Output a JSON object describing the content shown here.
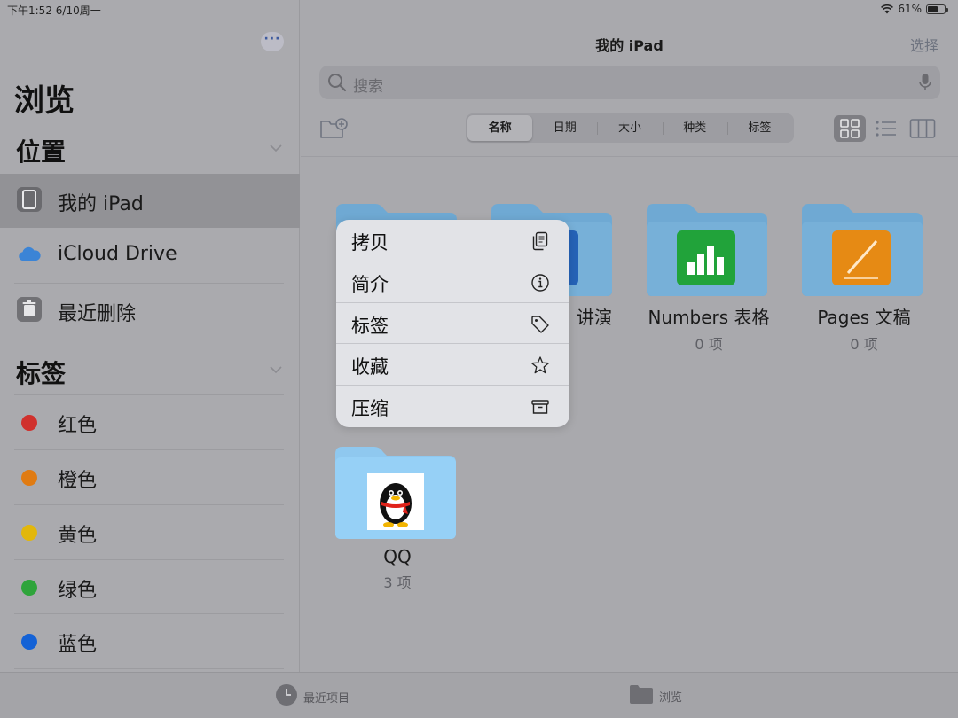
{
  "status_bar": {
    "time": "下午1:52   6/10周一",
    "battery": "61%",
    "battery_level": 0.61
  },
  "sidebar": {
    "more_label": "···",
    "title": "浏览",
    "locations_header": "位置",
    "locations": [
      {
        "label": "我的 iPad",
        "icon": "ipad-icon",
        "selected": true
      },
      {
        "label": "iCloud Drive",
        "icon": "icloud-icon",
        "selected": false
      },
      {
        "label": "最近删除",
        "icon": "trash-icon",
        "selected": false
      }
    ],
    "tags_header": "标签",
    "tags": [
      {
        "label": "红色",
        "color": "#d0312d"
      },
      {
        "label": "橙色",
        "color": "#e07b12"
      },
      {
        "label": "黄色",
        "color": "#e2b70c"
      },
      {
        "label": "绿色",
        "color": "#2fa43b"
      },
      {
        "label": "蓝色",
        "color": "#1462d6"
      }
    ]
  },
  "main": {
    "title": "我的 iPad",
    "select_label": "选择",
    "search_placeholder": "搜索",
    "sort_options": [
      "名称",
      "日期",
      "大小",
      "种类",
      "标签"
    ],
    "active_sort": "名称",
    "folders": [
      {
        "name": "讲演",
        "count": "",
        "icon": "keynote-icon"
      },
      {
        "name": "Numbers 表格",
        "count": "0 项",
        "icon": "numbers-icon"
      },
      {
        "name": "Pages 文稿",
        "count": "0 项",
        "icon": "pages-icon"
      },
      {
        "name": "QQ",
        "count": "3 项",
        "icon": "qq-penguin-icon"
      }
    ]
  },
  "context_menu": {
    "items": [
      {
        "label": "拷贝",
        "icon": "copy-icon"
      },
      {
        "label": "简介",
        "icon": "info-icon"
      },
      {
        "label": "标签",
        "icon": "tag-icon"
      },
      {
        "label": "收藏",
        "icon": "star-icon"
      },
      {
        "label": "压缩",
        "icon": "archive-icon"
      }
    ]
  },
  "tab_bar": {
    "recents_label": "最近项目",
    "browse_label": "浏览"
  },
  "colors": {
    "folder_blue": "#6fa9d3",
    "folder_blue_light": "#8fc8ef",
    "accent": "#3d5a9e"
  }
}
